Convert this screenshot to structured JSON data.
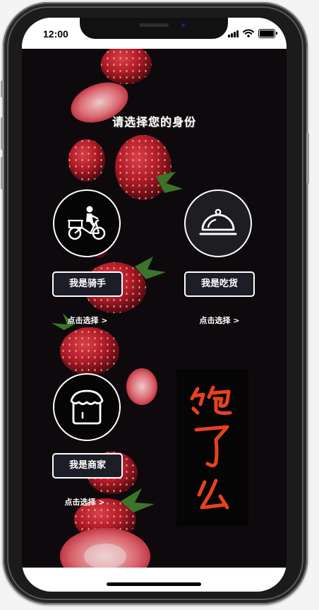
{
  "status_bar": {
    "time": "12:00"
  },
  "page": {
    "title": "请选择您的身份"
  },
  "roles": [
    {
      "icon": "bicycle-courier-icon",
      "button_label": "我是骑手",
      "link_label": "点击选择 >"
    },
    {
      "icon": "food-cloche-icon",
      "button_label": "我是吃货",
      "link_label": "点击选择 >"
    },
    {
      "icon": "storefront-icon",
      "button_label": "我是商家",
      "link_label": "点击选择 >"
    }
  ],
  "brand": {
    "logo_text": "饱了么",
    "logo_color": "#e8421c"
  },
  "colors": {
    "background": "#0e090c",
    "button_bg": "#1c1d27",
    "strawberry": "#c0202e"
  }
}
